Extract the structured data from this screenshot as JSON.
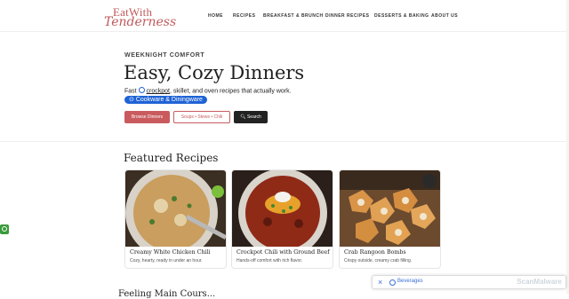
{
  "brand": {
    "line1": "EatWith",
    "line2": "Tenderness",
    "color": "#c0595b"
  },
  "nav": [
    {
      "label": "HOME"
    },
    {
      "label": "RECIPES"
    },
    {
      "label": "BREAKFAST & BRUNCH"
    },
    {
      "label": "DINNER RECIPES"
    },
    {
      "label": "DESSERTS & BAKING"
    },
    {
      "label": "ABOUT US"
    }
  ],
  "hero": {
    "eyebrow": "WEEKNIGHT COMFORT",
    "title": "Easy, Cozy Dinners",
    "lede_start": "Fast",
    "lede_link": "crockpot",
    "lede_end": ", skillet, and oven recipes that actually work.",
    "pill": "Cookware & Diningware",
    "buttons": {
      "primary": "Browse Dinners",
      "outline": "Soups • Stews • Chili",
      "search": "Search"
    }
  },
  "featured": {
    "heading": "Featured Recipes",
    "cards": [
      {
        "title": "Creamy White Chicken Chili",
        "desc": "Cozy, hearty, ready in under an hour."
      },
      {
        "title": "Crockpot Chili with Ground Beef",
        "desc": "Hands-off comfort with rich flavor."
      },
      {
        "title": "Crab Rangoon Bombs",
        "desc": "Crispy outside, creamy crab filling."
      }
    ]
  },
  "next_heading": "Feeling Main Cours...",
  "ad_bar": {
    "close": "×",
    "chip": "Beverages",
    "watermark": "ScanMalware"
  },
  "colors": {
    "accent": "#c95b5e",
    "link_blue": "#1e63d6",
    "badge_green": "#3a9a3a"
  }
}
